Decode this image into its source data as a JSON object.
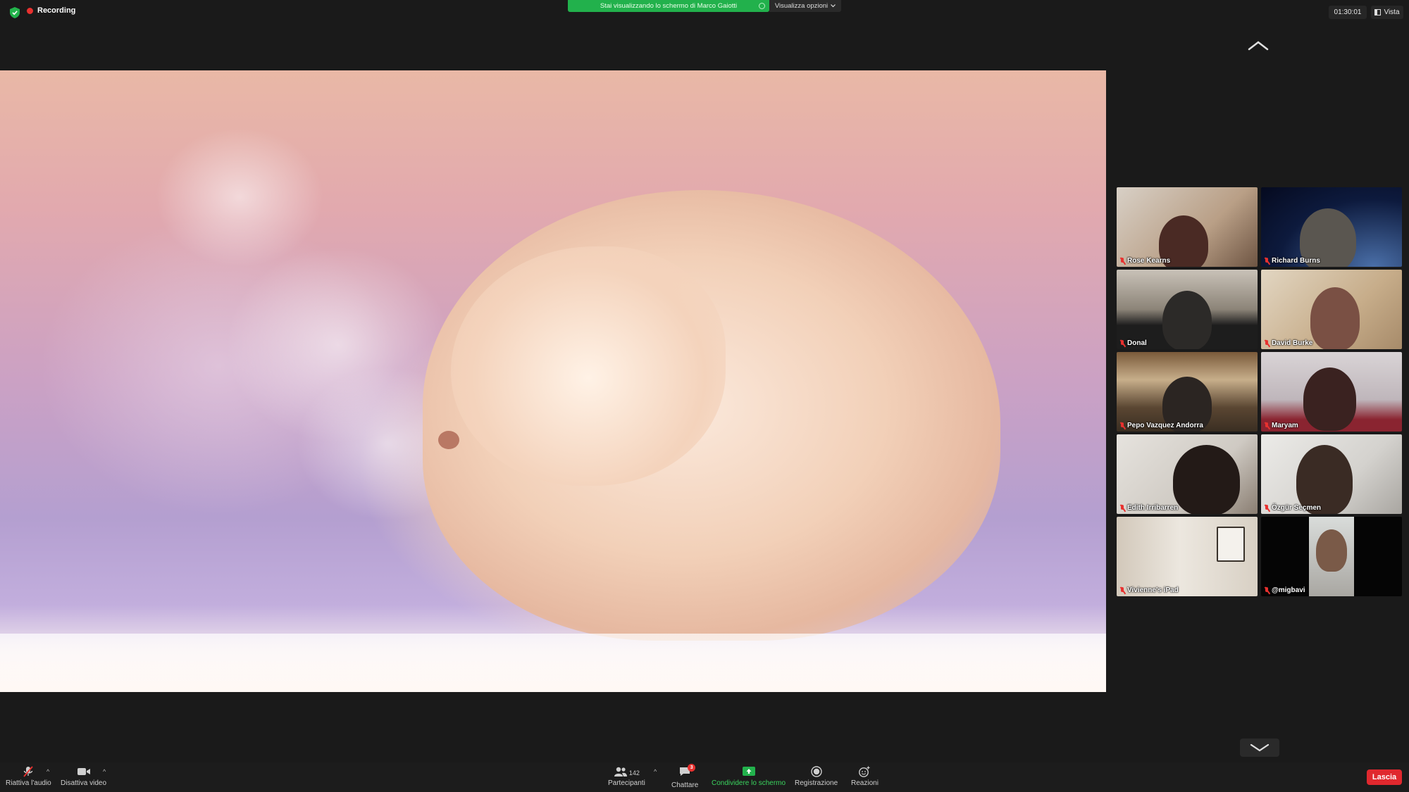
{
  "topbar": {
    "recording_label": "Recording",
    "share_banner": "Stai visualizzando lo schermo di Marco Gaiotti",
    "view_options": "Visualizza opzioni",
    "timer": "01:30:01",
    "view_label": "Vista"
  },
  "colors": {
    "share_green": "#22b14c",
    "leave_red": "#e0282e",
    "recording_red": "#e8312f",
    "background": "#1a1a1a"
  },
  "participants": [
    {
      "name": "Rose Kearns",
      "muted": true
    },
    {
      "name": "Richard Burns",
      "muted": true
    },
    {
      "name": "Donal",
      "muted": true
    },
    {
      "name": "David Burke",
      "muted": true
    },
    {
      "name": "Pepo Vazquez Andorra",
      "muted": true
    },
    {
      "name": "Maryam",
      "muted": true
    },
    {
      "name": "Edith Irribarren",
      "muted": true
    },
    {
      "name": "Özgür Seçmen",
      "muted": true
    },
    {
      "name": "Vivienne's iPad",
      "muted": true
    },
    {
      "name": "@migbavi",
      "muted": true
    }
  ],
  "toolbar": {
    "unmute_label": "Riattiva l'audio",
    "video_label": "Disattiva video",
    "participants_label": "Partecipanti",
    "participants_count": "142",
    "chat_label": "Chattare",
    "chat_badge": "3",
    "share_label": "Condividere lo schermo",
    "record_label": "Registrazione",
    "reactions_label": "Reazioni",
    "leave_label": "Lascia"
  }
}
